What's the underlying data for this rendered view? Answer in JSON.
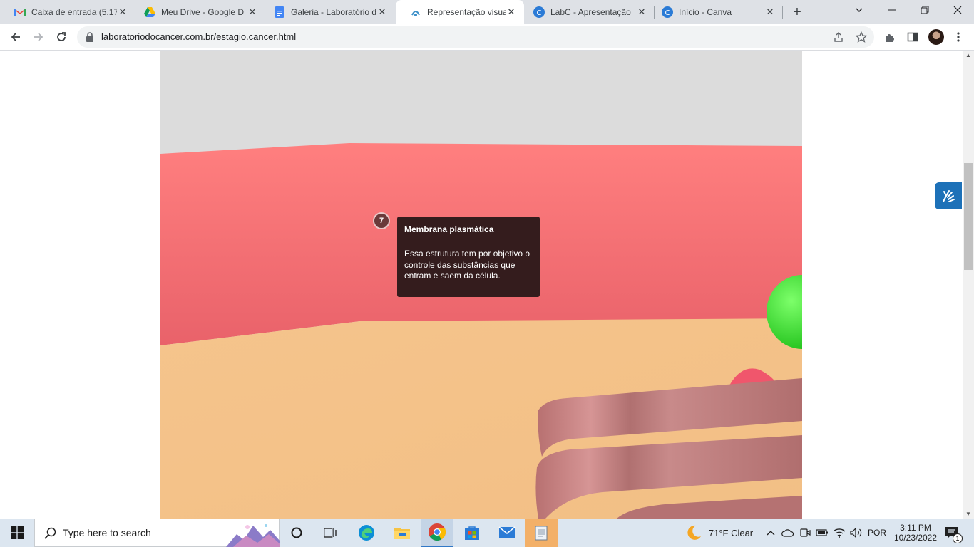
{
  "browser": {
    "tabs": [
      {
        "title": "Caixa de entrada (5.17",
        "icon": "gmail-icon",
        "active": false
      },
      {
        "title": "Meu Drive - Google D",
        "icon": "google-drive-icon",
        "active": false
      },
      {
        "title": "Galeria - Laboratório d",
        "icon": "google-docs-icon",
        "active": false
      },
      {
        "title": "Representação visual d",
        "icon": "site-favicon",
        "active": true
      },
      {
        "title": "LabC - Apresentação",
        "icon": "canva-icon",
        "active": false
      },
      {
        "title": "Início - Canva",
        "icon": "canva-icon",
        "active": false
      }
    ],
    "url": "laboratoriodocancer.com.br/estagio.cancer.html"
  },
  "page": {
    "hotspot_number": "7",
    "tooltip": {
      "title": "Membrana plasmática",
      "body": "Essa estrutura tem por objetivo o controle das substâncias que entram e saem da célula."
    },
    "scene_colors": {
      "wall": "#ff7a7a",
      "floor": "#f5c48c",
      "sky": "#dcdcdc",
      "green_sphere": "#3ee03a",
      "ribbon": "#b87474"
    }
  },
  "taskbar": {
    "search_placeholder": "Type here to search",
    "weather": "71°F  Clear",
    "language": "POR",
    "time": "3:11 PM",
    "date": "10/23/2022",
    "notification_count": "1"
  }
}
